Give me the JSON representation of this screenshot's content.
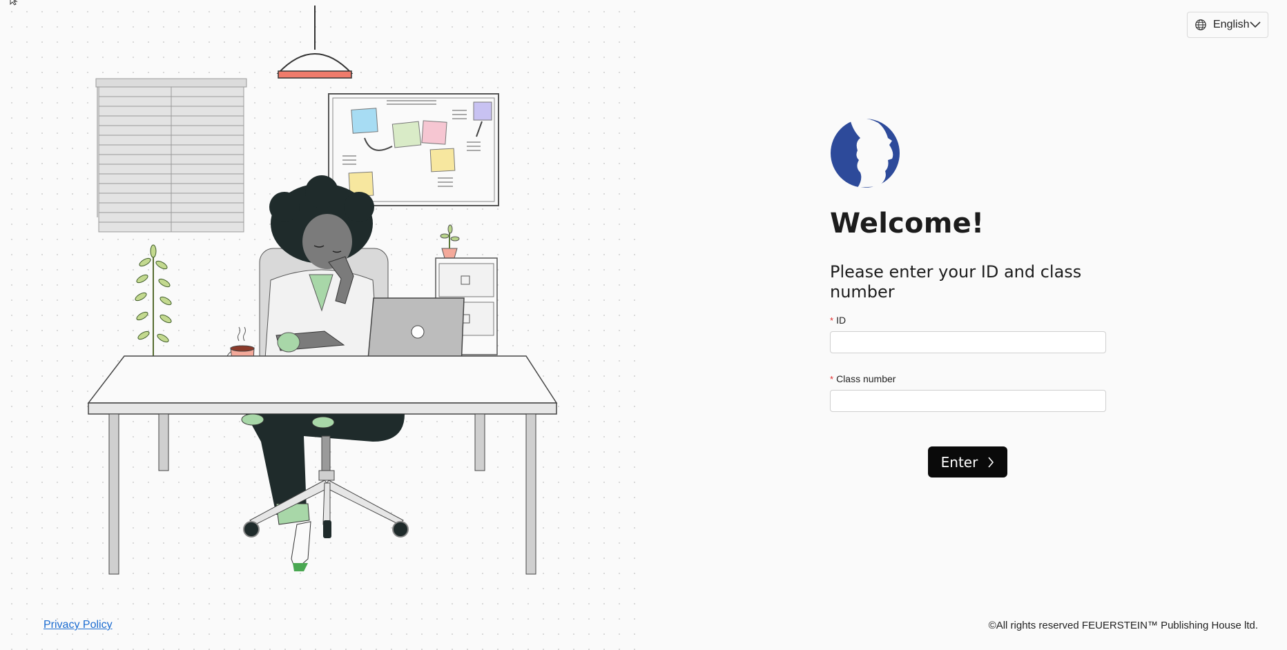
{
  "language": {
    "selected": "English",
    "icon": "globe-icon"
  },
  "form": {
    "title": "Welcome!",
    "subtitle": "Please enter your ID and class number",
    "id_label": "ID",
    "id_value": "",
    "class_label": "Class number",
    "class_value": "",
    "required_marker": "*",
    "submit_label": "Enter"
  },
  "footer": {
    "privacy_link": "Privacy Policy",
    "copyright": "©All rights reserved FEUERSTEIN™ Publishing House ltd."
  },
  "colors": {
    "accent_dark": "#0a0a0a",
    "logo_blue": "#2d4a9a",
    "link": "#1a6bd0",
    "required": "#e02c2c"
  }
}
